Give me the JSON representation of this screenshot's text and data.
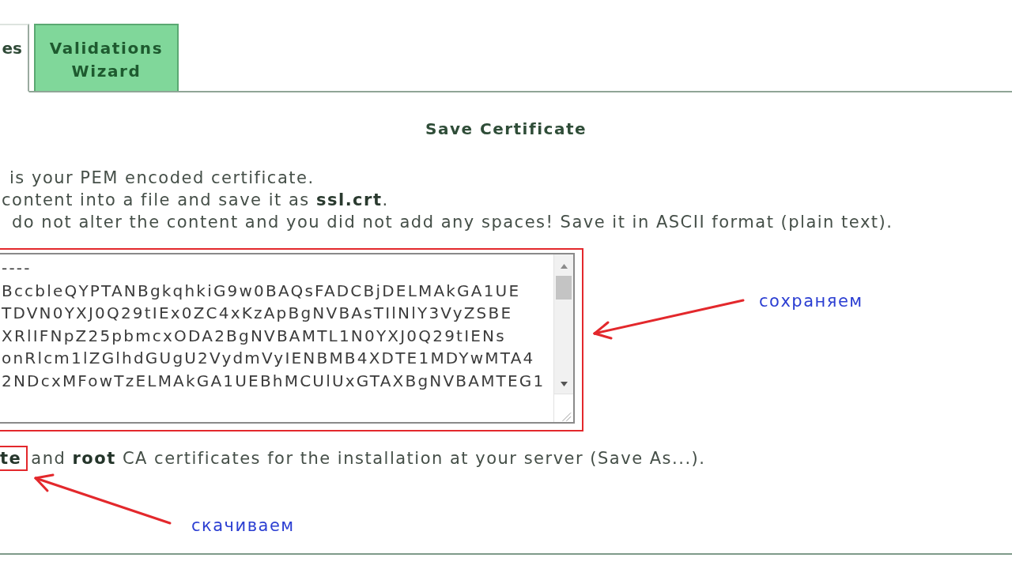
{
  "tabs": [
    {
      "label": "es",
      "selected": true
    },
    {
      "label": "Validations Wizard",
      "selected": false
    }
  ],
  "panel": {
    "title": "Save Certificate",
    "instructions": [
      "is your PEM encoded certificate.",
      "content into a file and save it as **ssl.crt**.",
      "do not alter the content and you did not add any spaces! Save it in ASCII format (plain text)."
    ],
    "certificate": {
      "lines": [
        "----",
        "BccbleQYPTANBgkqhkiG9w0BAQsFADCBjDELMAkGA1UE",
        "TDVN0YXJ0Q29tIEx0ZC4xKzApBgNVBAsTIlNlY3VyZSBE",
        "XRlIFNpZ25pbmcxODA2BgNVBAMTL1N0YXJ0Q29tIENs",
        "onRlcm1lZGlhdGUgU2VydmVyIENBMB4XDTE1MDYwMTA4",
        "2NDcxMFowTzELMAkGA1UEBhMCUlUxGTAXBgNVBAMTEG1"
      ],
      "annotation": "сохраняем"
    },
    "download_note": {
      "highlight": "te",
      "text": "and **root** CA certificates for the installation at your server (Save As...).",
      "annotation": "скачиваем"
    }
  }
}
